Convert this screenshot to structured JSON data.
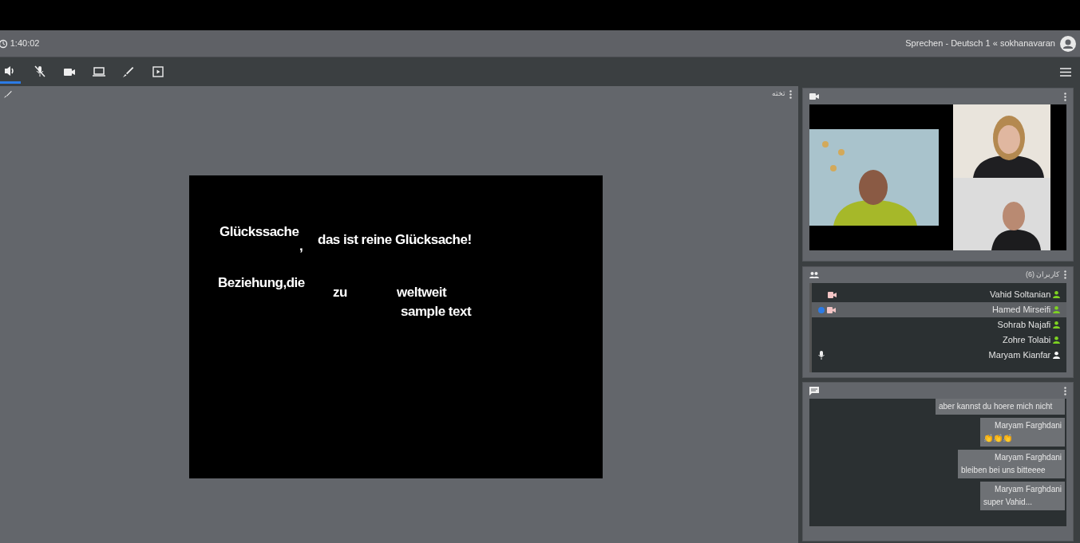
{
  "header": {
    "timer": "1:40:02",
    "title": "Sprechen - Deutsch 1 « sokhanavaran"
  },
  "toolbar": [
    {
      "kind": "speaker",
      "active": true
    },
    {
      "kind": "mic-off",
      "active": false
    },
    {
      "kind": "camera",
      "active": false
    },
    {
      "kind": "screen",
      "active": false
    },
    {
      "kind": "brush",
      "active": false
    },
    {
      "kind": "present",
      "active": false
    }
  ],
  "whiteboard": {
    "title": "تخته",
    "texts": [
      "Glückssache",
      ",",
      "das ist reine Glücksache!",
      "Beziehung,die",
      "zu",
      "weltweit",
      "sample text"
    ]
  },
  "users": {
    "title": "کاربران (6)",
    "items": [
      {
        "name": "Vahid Soltanian",
        "selected": false,
        "video": true,
        "microphone": false,
        "color": "#7ed321"
      },
      {
        "name": "Hamed Mirseifi",
        "selected": true,
        "video": true,
        "microphone": false,
        "color": "#7ed321"
      },
      {
        "name": "Sohrab Najafi",
        "selected": false,
        "video": false,
        "microphone": false,
        "color": "#7ed321"
      },
      {
        "name": "Zohre Tolabi",
        "selected": false,
        "video": false,
        "microphone": false,
        "color": "#7ed321"
      },
      {
        "name": "Maryam Kianfar",
        "selected": false,
        "video": false,
        "microphone": true,
        "color": "#ffffff"
      }
    ]
  },
  "chat": {
    "messages": [
      {
        "text": "aber kannst du hoere mich nicht"
      },
      {
        "sender": "Maryam Farghdani",
        "text": "👏👏👏"
      },
      {
        "sender": "Maryam Farghdani",
        "text": "bleiben bei uns bitteeee"
      },
      {
        "sender": "Maryam Farghdani",
        "text": "super Vahid..."
      }
    ]
  }
}
